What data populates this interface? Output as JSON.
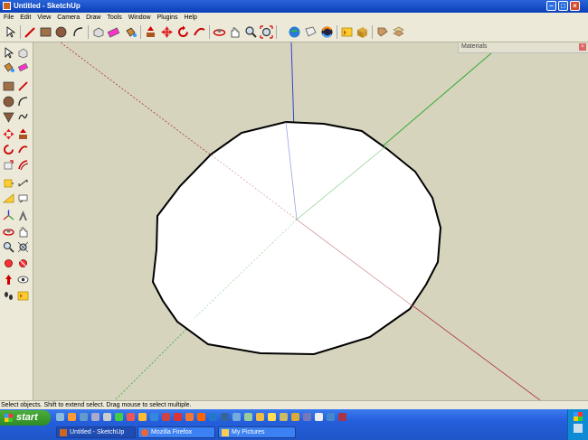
{
  "window": {
    "title": "Untitled - SketchUp"
  },
  "menu": {
    "items": [
      "File",
      "Edit",
      "View",
      "Camera",
      "Draw",
      "Tools",
      "Window",
      "Plugins",
      "Help"
    ]
  },
  "toolbar": {
    "icons": [
      "select-arrow-icon",
      "pencil-line-icon",
      "rectangle-icon",
      "circle-icon",
      "arc-icon",
      "make-component-icon",
      "eraser-icon",
      "paint-bucket-icon",
      "push-pull-icon",
      "move-icon",
      "rotate-icon",
      "follow-me-icon",
      "orbit-icon",
      "pan-icon",
      "zoom-icon",
      "zoom-extents-icon",
      "get-models-icon",
      "share-model-icon",
      "google-earth-icon",
      "section-plane-icon",
      "components-icon",
      "materials-icon",
      "layers-icon"
    ]
  },
  "materials_panel": {
    "title": "Materials"
  },
  "statusbar": {
    "text": "Select objects. Shift to extend select. Drag mouse to select multiple."
  },
  "taskbar": {
    "start_label": "start",
    "tasks": [
      {
        "label": "Untitled - SketchUp",
        "active": true,
        "icon": "sketchup-icon"
      },
      {
        "label": "Mozilla Firefox",
        "active": false,
        "icon": "firefox-icon"
      },
      {
        "label": "My Pictures",
        "active": false,
        "icon": "folder-icon"
      }
    ]
  },
  "colors": {
    "title_blue": "#0a3fb8",
    "viewport_bg": "#d7d4be",
    "axis_blue": "#3344cc",
    "axis_green": "#33aa33",
    "axis_red": "#aa3333",
    "start_green": "#2f8a25",
    "taskbar_blue": "#245edb"
  }
}
